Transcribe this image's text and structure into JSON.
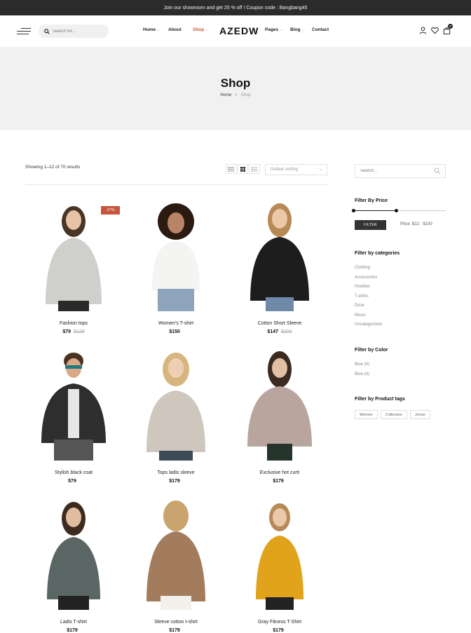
{
  "topbar": {
    "text": "Join our showroom and get 25 % off ! Coupon code : Bangbang45"
  },
  "header": {
    "search_placeholder": "Search for...",
    "logo": "AZEDW",
    "nav": [
      {
        "label": "Home",
        "has_dropdown": true
      },
      {
        "label": "About",
        "has_dropdown": false
      },
      {
        "label": "Shop",
        "has_dropdown": true,
        "active": true
      },
      {
        "label": "Pages",
        "has_dropdown": true
      },
      {
        "label": "Blog",
        "has_dropdown": true
      },
      {
        "label": "Contact",
        "has_dropdown": false
      }
    ],
    "cart_count": "0",
    "icons": [
      "menu-icon",
      "search-icon",
      "user-icon",
      "heart-icon",
      "cart-icon"
    ]
  },
  "banner": {
    "title": "Shop",
    "breadcrumb": {
      "home": "Home",
      "separator": ">",
      "current": "Shop"
    }
  },
  "toolbar": {
    "showing": "Showing 1–12 of 70 results",
    "sort_selected": "Default sorting",
    "view_icons": [
      "grid-small-icon",
      "grid-large-icon",
      "list-icon"
    ]
  },
  "products": [
    {
      "name": "Fashion tops",
      "price": "$79",
      "old_price": "$129",
      "sale_badge": "-27%"
    },
    {
      "name": "Women’s T-shirt",
      "price": "$150",
      "old_price": ""
    },
    {
      "name": "Cotton Short Sleeve",
      "price": "$147",
      "old_price": "$200"
    },
    {
      "name": "Stylish black coat",
      "price": "$79",
      "old_price": ""
    },
    {
      "name": "Tops ladis sleeve",
      "price": "$179",
      "old_price": ""
    },
    {
      "name": "Exclusive hot curti",
      "price": "$179",
      "old_price": ""
    },
    {
      "name": "Ladis T-shirt",
      "price": "$179",
      "old_price": ""
    },
    {
      "name": "Sleeve cotton t-shirt",
      "price": "$179",
      "old_price": ""
    },
    {
      "name": "Gray Fitness T-Shirt",
      "price": "$179",
      "old_price": ""
    }
  ],
  "sidebar": {
    "search_placeholder": "Search...",
    "price_filter": {
      "title": "Filter By Price",
      "button": "FILTER",
      "range_text": "Price :$12 - $100"
    },
    "categories": {
      "title": "Filter by categories",
      "items": [
        "Clothing",
        "Accessories",
        "Hoodies",
        "T-shirts",
        "Dicor",
        "Music",
        "Uncategorized"
      ]
    },
    "colors": {
      "title": "Filter by Color",
      "items": [
        "Blue (4)",
        "Blue (4)"
      ]
    },
    "tags": {
      "title": "Filter by Product tags",
      "items": [
        "Women",
        "Collection",
        "Jense"
      ]
    }
  },
  "colors": {
    "accent": "#c8553d",
    "dark": "#2b2b2b",
    "banner_bg": "#f1f1f1"
  }
}
